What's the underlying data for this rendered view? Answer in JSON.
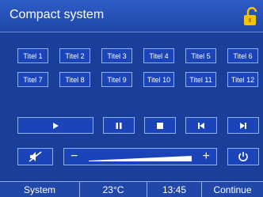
{
  "header": {
    "title": "Compact system"
  },
  "tracks": {
    "row1": [
      "Titel 1",
      "Titel 2",
      "Titel 3",
      "Titel 4",
      "Titel 5",
      "Titel 6"
    ],
    "row2": [
      "Titel 7",
      "Titel 8",
      "Titel 9",
      "Titel 10",
      "Titel 11",
      "Titel 12"
    ]
  },
  "volume": {
    "minus": "−",
    "plus": "+"
  },
  "footer": {
    "system": "System",
    "temperature": "23°C",
    "time": "13:45",
    "continue": "Continue"
  },
  "colors": {
    "background": "#1a3f9a",
    "border": "#8fb0ff",
    "button": "#1b44b8",
    "lock": "#f5c400"
  }
}
